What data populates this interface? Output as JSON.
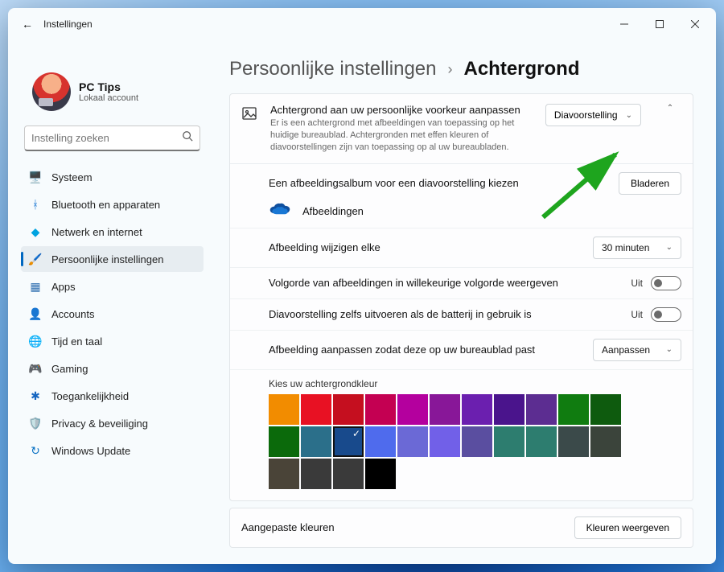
{
  "window": {
    "title": "Instellingen"
  },
  "profile": {
    "name": "PC Tips",
    "sub": "Lokaal account"
  },
  "search": {
    "placeholder": "Instelling zoeken"
  },
  "nav": [
    {
      "icon": "🖥️",
      "label": "Systeem"
    },
    {
      "icon": "ᚼ",
      "label": "Bluetooth en apparaten",
      "color": "#1976d2"
    },
    {
      "icon": "◆",
      "label": "Netwerk en internet",
      "color": "#00a3e0"
    },
    {
      "icon": "🖌️",
      "label": "Persoonlijke instellingen",
      "active": true
    },
    {
      "icon": "▦",
      "label": "Apps",
      "color": "#2f6fb0"
    },
    {
      "icon": "👤",
      "label": "Accounts",
      "color": "#2e8b57"
    },
    {
      "icon": "🌐",
      "label": "Tijd en taal",
      "color": "#555"
    },
    {
      "icon": "🎮",
      "label": "Gaming",
      "color": "#555"
    },
    {
      "icon": "✱",
      "label": "Toegankelijkheid",
      "color": "#1565c0"
    },
    {
      "icon": "🛡️",
      "label": "Privacy & beveiliging",
      "color": "#777"
    },
    {
      "icon": "↻",
      "label": "Windows Update",
      "color": "#0b72c4"
    }
  ],
  "breadcrumb": {
    "parent": "Persoonlijke instellingen",
    "sep": "›",
    "current": "Achtergrond"
  },
  "bg_panel": {
    "title": "Achtergrond aan uw persoonlijke voorkeur aanpassen",
    "desc": "Er is een achtergrond met afbeeldingen van toepassing op het huidige bureaublad. Achtergronden met effen kleuren of diavoorstellingen zijn van toepassing op al uw bureaubladen.",
    "mode": "Diavoorstelling"
  },
  "album": {
    "label": "Een afbeeldingsalbum voor een diavoorstelling kiezen",
    "btn": "Bladeren",
    "folder": "Afbeeldingen"
  },
  "interval": {
    "label": "Afbeelding wijzigen elke",
    "value": "30 minuten"
  },
  "shuffle": {
    "label": "Volgorde van afbeeldingen in willekeurige volgorde weergeven",
    "state": "Uit"
  },
  "battery": {
    "label": "Diavoorstelling zelfs uitvoeren als de batterij in gebruik is",
    "state": "Uit"
  },
  "fit": {
    "label": "Afbeelding aanpassen zodat deze op uw bureaublad past",
    "value": "Aanpassen"
  },
  "color_section": {
    "label": "Kies uw achtergrondkleur",
    "colors": [
      "#f28c00",
      "#e81123",
      "#c50f1f",
      "#c40052",
      "#b4009e",
      "#881798",
      "#6b1faf",
      "#4a148c",
      "#5c2d91",
      "#107c10",
      "#0e5b0e",
      "#0b6a0b",
      "#2b6f8a",
      "#184a8c",
      "#4f6bed",
      "#6b69d6",
      "#7160e8",
      "#5a4ea0",
      "#2d7d6f",
      "#2d7d6f",
      "#3b4a4a",
      "#3b443b",
      "#4a4438",
      "#3a3a3a",
      "#3a3a3a",
      "#000000"
    ],
    "selected_index": 13
  },
  "custom": {
    "label": "Aangepaste kleuren",
    "btn": "Kleuren weergeven"
  }
}
